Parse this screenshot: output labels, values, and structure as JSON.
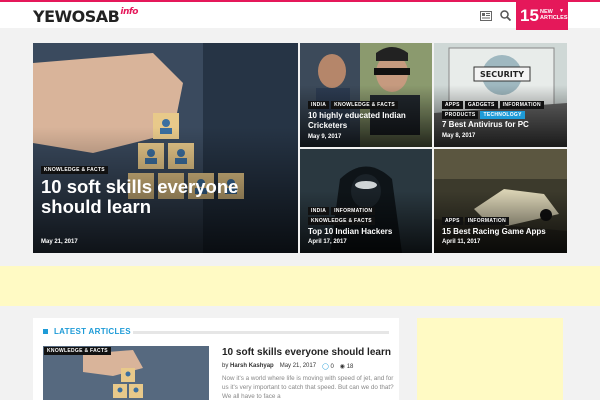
{
  "header": {
    "logo_main": "YEWOSAB",
    "logo_suffix": "info",
    "new_articles_count": "15",
    "new_articles_label": "NEW ARTICLES",
    "icons": [
      "newspaper-icon",
      "search-icon",
      "chevron-down-icon"
    ]
  },
  "tiles": [
    {
      "tags": [
        "KNOWLEDGE & FACTS"
      ],
      "title": "10 soft skills everyone should learn",
      "date": "May 21, 2017"
    },
    {
      "tags": [
        "INDIA",
        "KNOWLEDGE & FACTS"
      ],
      "title": "10 highly educated Indian Cricketers",
      "date": "May 9, 2017"
    },
    {
      "tags": [
        "APPS",
        "GADGETS",
        "INFORMATION",
        "PRODUCTS",
        "TECHNOLOGY"
      ],
      "title": "7 Best Antivirus for PC",
      "date": "May 8, 2017"
    },
    {
      "tags": [
        "INDIA",
        "INFORMATION",
        "KNOWLEDGE & FACTS"
      ],
      "title": "Top 10 Indian Hackers",
      "date": "April 17, 2017"
    },
    {
      "tags": [
        "APPS",
        "INFORMATION"
      ],
      "title": "15 Best Racing Game Apps",
      "date": "April 11, 2017"
    }
  ],
  "latest": {
    "heading": "LATEST ARTICLES",
    "article": {
      "tag": "KNOWLEDGE & FACTS",
      "title": "10 soft skills everyone should learn",
      "author": "Harsh Kashyap",
      "date": "May 21, 2017",
      "comments": "0",
      "views": "18",
      "excerpt": "Now it's a world where life is moving with speed of jet, and for us it's very important to catch that speed. But can we do that? We all have to face a"
    }
  },
  "colors": {
    "brand": "#e5185a",
    "accent": "#1e9bd7",
    "ad_band": "#fffac4"
  }
}
